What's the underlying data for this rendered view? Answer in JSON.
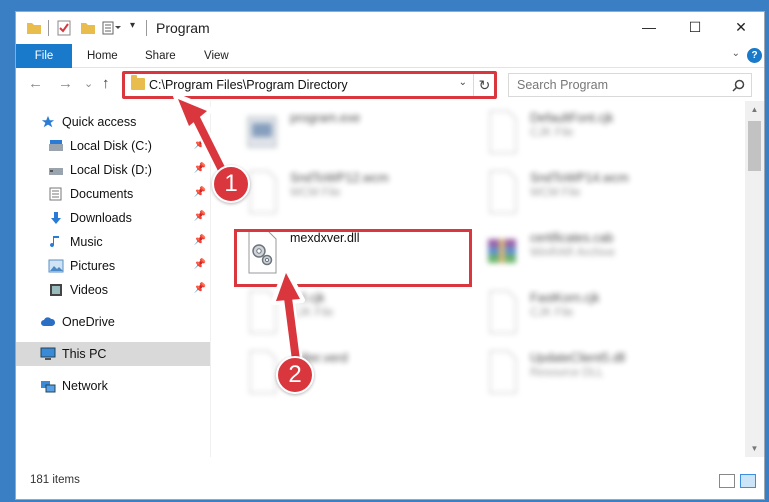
{
  "window": {
    "title": "Program",
    "minimize_glyph": "—",
    "maximize_glyph": "☐",
    "close_glyph": "✕"
  },
  "ribbon": {
    "tabs": [
      {
        "label": "File"
      },
      {
        "label": "Home"
      },
      {
        "label": "Share"
      },
      {
        "label": "View"
      }
    ],
    "help_glyph": "?"
  },
  "navigation": {
    "back_glyph": "←",
    "forward_glyph": "→",
    "recent_glyph": "⌄",
    "up_glyph": "↑",
    "address": "C:\\Program Files\\Program Directory",
    "refresh_glyph": "↻",
    "search_placeholder": "Search Program"
  },
  "sidebar": {
    "items": [
      {
        "label": "Quick access",
        "icon": "star-icon"
      },
      {
        "label": "Local Disk (C:)",
        "icon": "drive-icon",
        "pinned": true
      },
      {
        "label": "Local Disk (D:)",
        "icon": "drive-icon",
        "pinned": true
      },
      {
        "label": "Documents",
        "icon": "documents-icon",
        "pinned": true
      },
      {
        "label": "Downloads",
        "icon": "download-icon",
        "pinned": true
      },
      {
        "label": "Music",
        "icon": "music-icon",
        "pinned": true
      },
      {
        "label": "Pictures",
        "icon": "pictures-icon",
        "pinned": true
      },
      {
        "label": "Videos",
        "icon": "video-icon",
        "pinned": true
      },
      {
        "label": "OneDrive",
        "icon": "cloud-icon"
      },
      {
        "label": "This PC",
        "icon": "computer-icon",
        "selected": true
      },
      {
        "label": "Network",
        "icon": "network-icon"
      }
    ]
  },
  "files": [
    {
      "name": "program.exe",
      "type": "",
      "icon": "exe-icon"
    },
    {
      "name": "DefaultFont.cjk",
      "type": "CJK File",
      "icon": "generic-file-icon"
    },
    {
      "name": "SndToWP12.wcm",
      "type": "WCM File",
      "icon": "generic-file-icon"
    },
    {
      "name": "SndToWP14.wcm",
      "type": "WCM File",
      "icon": "generic-file-icon"
    },
    {
      "name": "mexdxver.dll",
      "type": "",
      "icon": "dll-gear-icon"
    },
    {
      "name": "certificates.cab",
      "type": "WinRAR Archive",
      "icon": "winrar-icon"
    },
    {
      "name": "...ll.cjk",
      "type": "CJK File",
      "icon": "generic-file-icon"
    },
    {
      "name": "FastKorn.cjk",
      "type": "CJK File",
      "icon": "generic-file-icon"
    },
    {
      "name": "...ilter.verd",
      "type": "...ile",
      "icon": "generic-file-icon"
    },
    {
      "name": "UpdateClient5.dll",
      "type": "Resource DLL",
      "icon": "generic-file-icon"
    }
  ],
  "status": {
    "item_count": "181 items"
  },
  "annotations": {
    "step1": "1",
    "step2": "2",
    "color": "#d9363e"
  },
  "colors": {
    "accent": "#1979ca",
    "folder": "#e8bd4d",
    "selection": "#d9d9d9"
  }
}
